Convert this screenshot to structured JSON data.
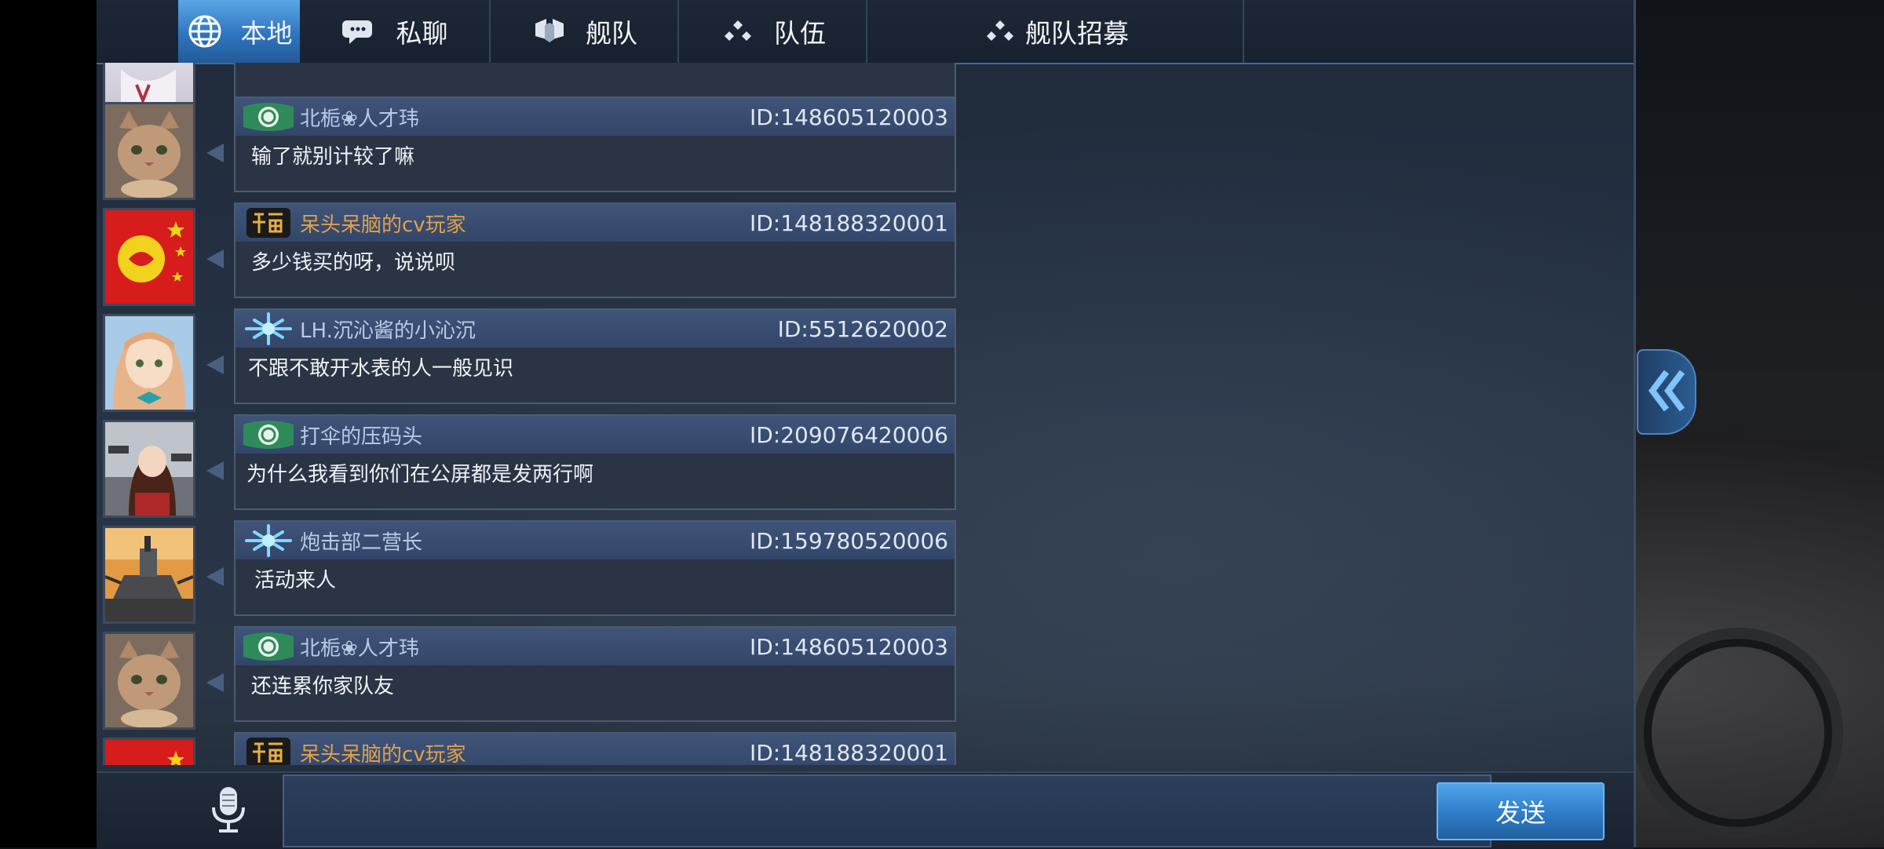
{
  "tabs": [
    {
      "label": "本地",
      "icon": "globe-icon",
      "active": true
    },
    {
      "label": "私聊",
      "icon": "speech-bubble-icon",
      "active": false
    },
    {
      "label": "舰队",
      "icon": "fleet-shield-icon",
      "active": false
    },
    {
      "label": "队伍",
      "icon": "team-dots-icon",
      "active": false
    },
    {
      "label": "舰队招募",
      "icon": "team-dots-icon",
      "active": false
    }
  ],
  "messages": [
    {
      "sender": "北栀❀人才玮",
      "id": "ID:148605120003",
      "text": "输了就别计较了嘛",
      "badge": "green-emblem",
      "avatar": "cat"
    },
    {
      "sender": "呆头呆脑的cv玩家",
      "id": "ID:148188320001",
      "text": "多少钱买的呀，说说呗",
      "badge": "fu-badge",
      "avatar": "red-flag"
    },
    {
      "sender": "LH.沉沁酱的小沁沉",
      "id": "ID:5512620002",
      "text": "不跟不敢开水表的人一般见识",
      "badge": "snowflake-badge",
      "avatar": "anime-girl"
    },
    {
      "sender": "打伞的压码头",
      "id": "ID:209076420006",
      "text": "为什么我看到你们在公屏都是发两行啊",
      "badge": "green-emblem",
      "avatar": "anime-warship-girl"
    },
    {
      "sender": "炮击部二营长",
      "id": "ID:159780520006",
      "text": "活动来人",
      "badge": "snowflake-badge",
      "avatar": "battleship"
    },
    {
      "sender": "北栀❀人才玮",
      "id": "ID:148605120003",
      "text": "还连累你家队友",
      "badge": "green-emblem",
      "avatar": "cat"
    },
    {
      "sender": "呆头呆脑的cv玩家",
      "id": "ID:148188320001",
      "text": "",
      "badge": "fu-badge",
      "avatar": "red-flag"
    }
  ],
  "input": {
    "value": "",
    "placeholder": ""
  },
  "send_label": "发送",
  "colors": {
    "tab_active": "#3b8ad6",
    "sender_default": "#b8cbe6",
    "sender_gold": "#e2a24a",
    "bubble_head": "#3f5479"
  }
}
